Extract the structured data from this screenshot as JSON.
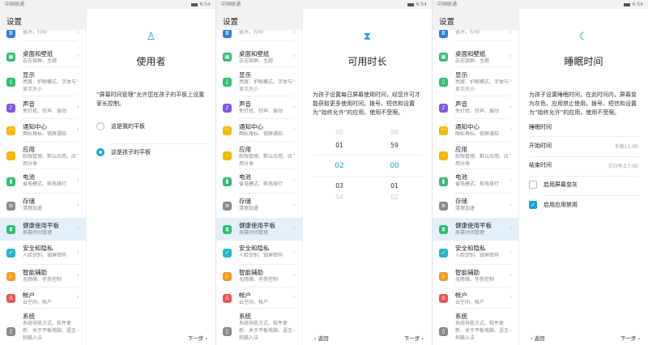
{
  "status": {
    "carrier": "中国联通",
    "time": "6:54"
  },
  "sidebar": {
    "title": "设置",
    "items": [
      {
        "title": "",
        "sub": "蓝牙、打印",
        "color": "#2f7de1",
        "icon": "bluetooth-icon",
        "glyph": "B"
      },
      {
        "title": "桌面和壁纸",
        "sub": "杂志锁屏、主题",
        "color": "#2dbf6e",
        "icon": "wallpaper-icon",
        "glyph": "▣"
      },
      {
        "title": "显示",
        "sub": "亮度、护眼模式、字体与显示大小",
        "color": "#2dbf6e",
        "icon": "display-icon",
        "glyph": "▯"
      },
      {
        "title": "声音",
        "sub": "免打扰、铃声、振动",
        "color": "#7b5ce6",
        "icon": "sound-icon",
        "glyph": "♪"
      },
      {
        "title": "通知中心",
        "sub": "图标角标、锁屏通知",
        "color": "#f5b800",
        "icon": "bell-icon",
        "glyph": "◠"
      },
      {
        "title": "应用",
        "sub": "权限管理、默认应用、应用分身",
        "color": "#f5b800",
        "icon": "apps-icon",
        "glyph": "⁘"
      },
      {
        "title": "电池",
        "sub": "省电模式、耗电排行",
        "color": "#2dbf6e",
        "icon": "battery-icon",
        "glyph": "▮"
      },
      {
        "title": "存储",
        "sub": "清理加速",
        "color": "#8a8a8a",
        "icon": "storage-icon",
        "glyph": "≡"
      },
      {
        "title": "健康使用平板",
        "sub": "屏幕时间管理",
        "color": "#2dbf6e",
        "icon": "hourglass-icon",
        "glyph": "⧗"
      },
      {
        "title": "安全和隐私",
        "sub": "人脸识别、锁屏密码",
        "color": "#26b6c9",
        "icon": "shield-icon",
        "glyph": "✓"
      },
      {
        "title": "智能辅助",
        "sub": "无障碍、手势控制",
        "color": "#f5962c",
        "icon": "hand-icon",
        "glyph": "✋"
      },
      {
        "title": "帐户",
        "sub": "云空间、帐户",
        "color": "#ef5350",
        "icon": "account-icon",
        "glyph": "♙"
      },
      {
        "title": "系统",
        "sub": "系统导航方式、软件更新、关于平板电脑、语言和输入法",
        "color": "#8a8a8a",
        "icon": "system-icon",
        "glyph": "▯"
      }
    ]
  },
  "panel1": {
    "title": "使用者",
    "text": "“屏幕时间管理”允许您在孩子的平板上设置家长控制。",
    "options": [
      "这是我的平板",
      "这是孩子的平板"
    ],
    "selected": 1,
    "next": "下一步"
  },
  "panel2": {
    "title": "可用时长",
    "text": "为孩子设置每日屏幕使用时间，经您许可才能获取更多使用时间。拨号、短信和设置为“始终允许”的应用，使用不受限。",
    "hours": [
      "00",
      "01",
      "02",
      "03",
      "04"
    ],
    "minutes": [
      "58",
      "59",
      "00",
      "01",
      "02"
    ],
    "selected_hours": "02",
    "selected_minutes": "00",
    "back": "返回",
    "next": "下一步"
  },
  "panel3": {
    "title": "睡眠时间",
    "text": "为孩子设置睡眠时间，在此时间内，屏幕变为灰色，应用禁止使用。拨号、短信和设置为“始终允许”的应用，使用不受限。",
    "section": "睡眠时间",
    "start_label": "开始时间",
    "start_value": "半夜11:00",
    "end_label": "结束时间",
    "end_value": "次日早上7:00",
    "checks": [
      {
        "label": "启用屏幕变灰",
        "checked": false
      },
      {
        "label": "启用应用禁用",
        "checked": true
      }
    ],
    "back": "返回",
    "next": "下一步"
  },
  "colors": {
    "accent": "#1aa0d8"
  }
}
